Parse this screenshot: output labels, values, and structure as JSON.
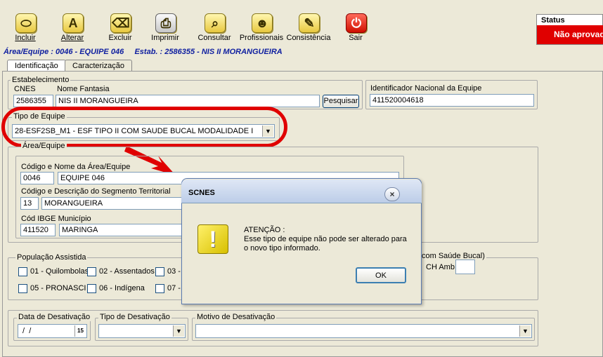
{
  "toolbar": {
    "buttons": [
      {
        "label": "Incluir",
        "glyph": "⬭"
      },
      {
        "label": "Alterar",
        "glyph": "A"
      },
      {
        "label": "Excluir",
        "glyph": "⌫"
      },
      {
        "label": "Imprimir",
        "glyph": "⎙"
      },
      {
        "label": "Consultar",
        "glyph": "⌕"
      },
      {
        "label": "Profissionais",
        "glyph": "☻"
      },
      {
        "label": "Consistência",
        "glyph": "✎"
      },
      {
        "label": "Sair",
        "glyph": "⏻"
      }
    ]
  },
  "status": {
    "title": "Status",
    "value": "Não aprovad"
  },
  "breadcrumb": "Área/Equipe : 0046 - EQUIPE 046     Estab. : 2586355 - NIS II MORANGUEIRA",
  "tabs": [
    "Identificação",
    "Caracterização"
  ],
  "estabelecimento": {
    "legend": "Estabelecimento",
    "cnes_label": "CNES",
    "cnes_value": "2586355",
    "nome_label": "Nome Fantasia",
    "nome_value": "NIS II MORANGUEIRA",
    "pesquisar": "Pesquisar"
  },
  "ine": {
    "label": "Identificador Nacional da Equipe",
    "value": "411520004618"
  },
  "tipo_equipe": {
    "legend": "Tipo de Equipe",
    "value": "28-ESF2SB_M1 - ESF TIPO II COM SAUDE BUCAL MODALIDADE I"
  },
  "area": {
    "legend": "Área/Equipe",
    "codigo_label": "Código e Nome da Área/Equipe",
    "codigo_value": "0046",
    "nome_value": "EQUIPE 046",
    "segmento_label": "Código e Descrição do Segmento Territorial",
    "segmento_codigo": "13",
    "segmento_desc": "MORANGUEIRA",
    "ibge_label": "Cód IBGE Município",
    "ibge_value": "411520",
    "municipio_value": "MARINGA"
  },
  "populacao": {
    "legend": "População Assistida",
    "options": [
      "01 - Quilombolas",
      "02 - Assentados",
      "03 -",
      "05 - PRONASCI",
      "06 - Indígena",
      "07 -"
    ]
  },
  "saude_bucal": {
    "legend": "com Saúde Bucal)",
    "ch_label": "CH Amb"
  },
  "desativacao": {
    "data_legend": "Data de Desativação",
    "data_value": " /  /",
    "cal": "15",
    "tipo_legend": "Tipo de Desativação",
    "motivo_legend": "Motivo de Desativação"
  },
  "dialog": {
    "title": "SCNES",
    "close": "×",
    "heading": "ATENÇÃO :",
    "message": "Esse tipo de equipe não pode ser alterado para o novo tipo informado.",
    "ok": "OK",
    "icon_glyph": "!"
  }
}
